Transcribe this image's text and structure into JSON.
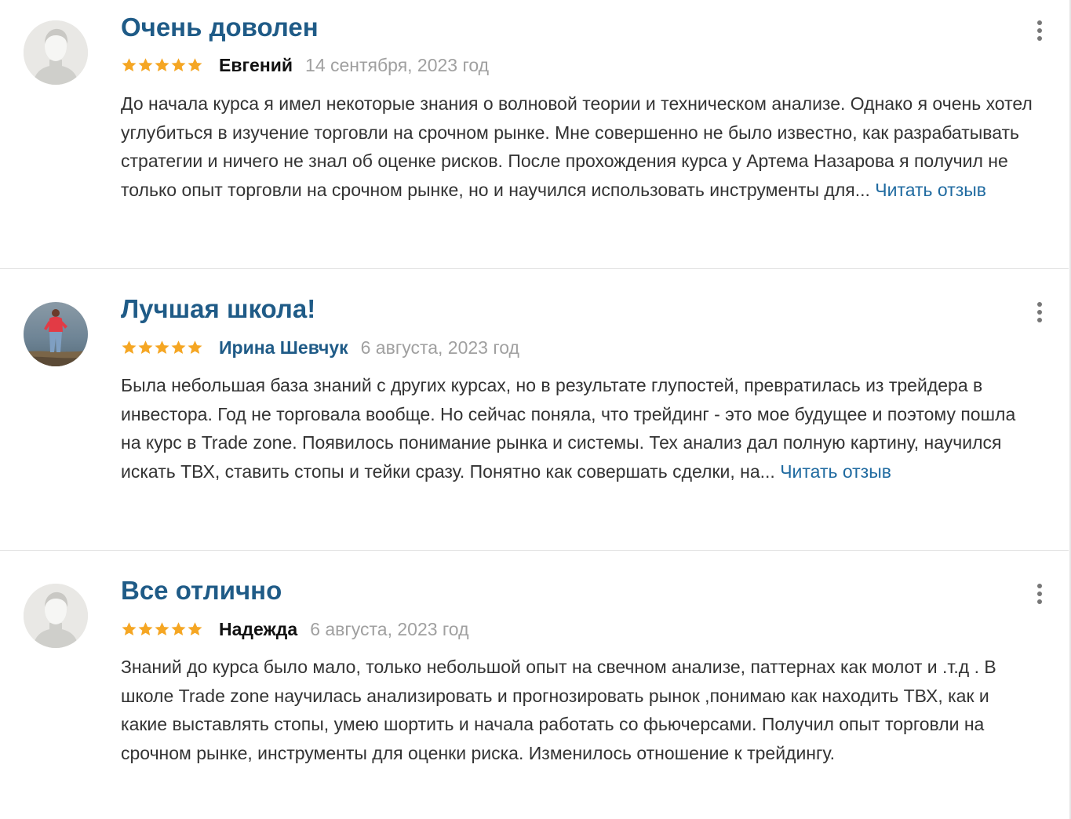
{
  "colors": {
    "title": "#1f5b87",
    "link": "#1f6aa0",
    "star": "#f5a623",
    "text": "#333333",
    "date": "#a0a0a0"
  },
  "reviews": [
    {
      "title": "Очень доволен",
      "rating": 5,
      "author": "Евгений",
      "author_is_link": false,
      "date": "14 сентября, 2023 год",
      "avatar": "default-avatar-icon",
      "text": "До начала курса я имел некоторые знания о волновой теории и техническом анализе. Однако я очень хотел углубиться в изучение торговли на срочном рынке. Мне совершенно не было известно, как разрабатывать стратегии и ничего не знал об оценке рисков. После прохождения курса у Артема Назарова я получил не только опыт торговли на срочном рынке, но и научился использовать инструменты для...",
      "read_more": "Читать отзыв"
    },
    {
      "title": "Лучшая школа!",
      "rating": 5,
      "author": "Ирина Шевчук",
      "author_is_link": true,
      "date": "6 августа, 2023 год",
      "avatar": "user-photo",
      "text": "Была небольшая база знаний с других курсах, но в результате глупостей, превратилась из трейдера в инвестора. Год не торговала вообще. Но сейчас поняла, что трейдинг - это мое будущее и поэтому пошла на курс в Trade zone. Появилось понимание рынка и системы. Тех анализ дал полную картину, научился искать ТВХ, ставить стопы и тейки сразу. Понятно как совершать сделки, на...",
      "read_more": "Читать отзыв"
    },
    {
      "title": "Все отлично",
      "rating": 5,
      "author": "Надежда",
      "author_is_link": false,
      "date": "6 августа, 2023 год",
      "avatar": "default-avatar-icon",
      "text": "Знаний до курса было мало, только небольшой опыт на свечном анализе, паттернах как молот и .т.д . В школе Trade zone научилась анализировать и прогнозировать рынок ,понимаю как находить ТВХ, как и какие выставлять стопы, умею шортить и начала работать со фьючерсами. Получил опыт торговли на срочном рынке, инструменты для оценки риска. Изменилось отношение к трейдингу."
    }
  ]
}
